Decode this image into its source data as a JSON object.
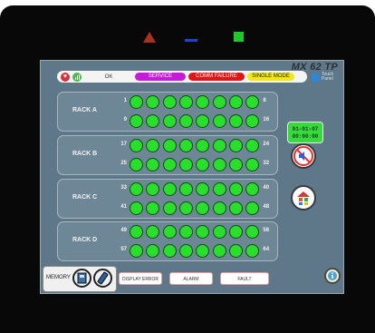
{
  "device": {
    "brand": "MX 62 TP",
    "logo_text": "Touch Panel"
  },
  "indicators": {
    "red_color": "#a8321d",
    "blue_color": "#1c46c8",
    "green_color": "#1ec82a"
  },
  "status_bar": {
    "ok_label": "OK",
    "service_label": "SERVICE",
    "comm_failure_label": "COMM FAILURE",
    "mode_label": "SINGLE MODE"
  },
  "racks": [
    {
      "label": "RACK A",
      "row1_start": "1",
      "row1_end": "8",
      "row2_start": "9",
      "row2_end": "16"
    },
    {
      "label": "RACK B",
      "row1_start": "17",
      "row1_end": "24",
      "row2_start": "25",
      "row2_end": "32"
    },
    {
      "label": "RACK C",
      "row1_start": "33",
      "row1_end": "40",
      "row2_start": "41",
      "row2_end": "48"
    },
    {
      "label": "RACK D",
      "row1_start": "49",
      "row1_end": "56",
      "row2_start": "57",
      "row2_end": "64"
    }
  ],
  "slot_status_color": "#2adf2c",
  "datetime": {
    "date": "01-01-07",
    "time": "00:00:00"
  },
  "icons": {
    "mute": "speaker-muted-icon",
    "menu": "menu-grid-icon",
    "info": "info-icon",
    "memory_card": "memory-card-icon",
    "usb": "usb-icon"
  },
  "bottom_bar": {
    "memory_label": "MEMORY",
    "display_error_label": "DISPLAY ERROR",
    "alarm_label": "ALARM",
    "fault_label": "FAULT"
  }
}
